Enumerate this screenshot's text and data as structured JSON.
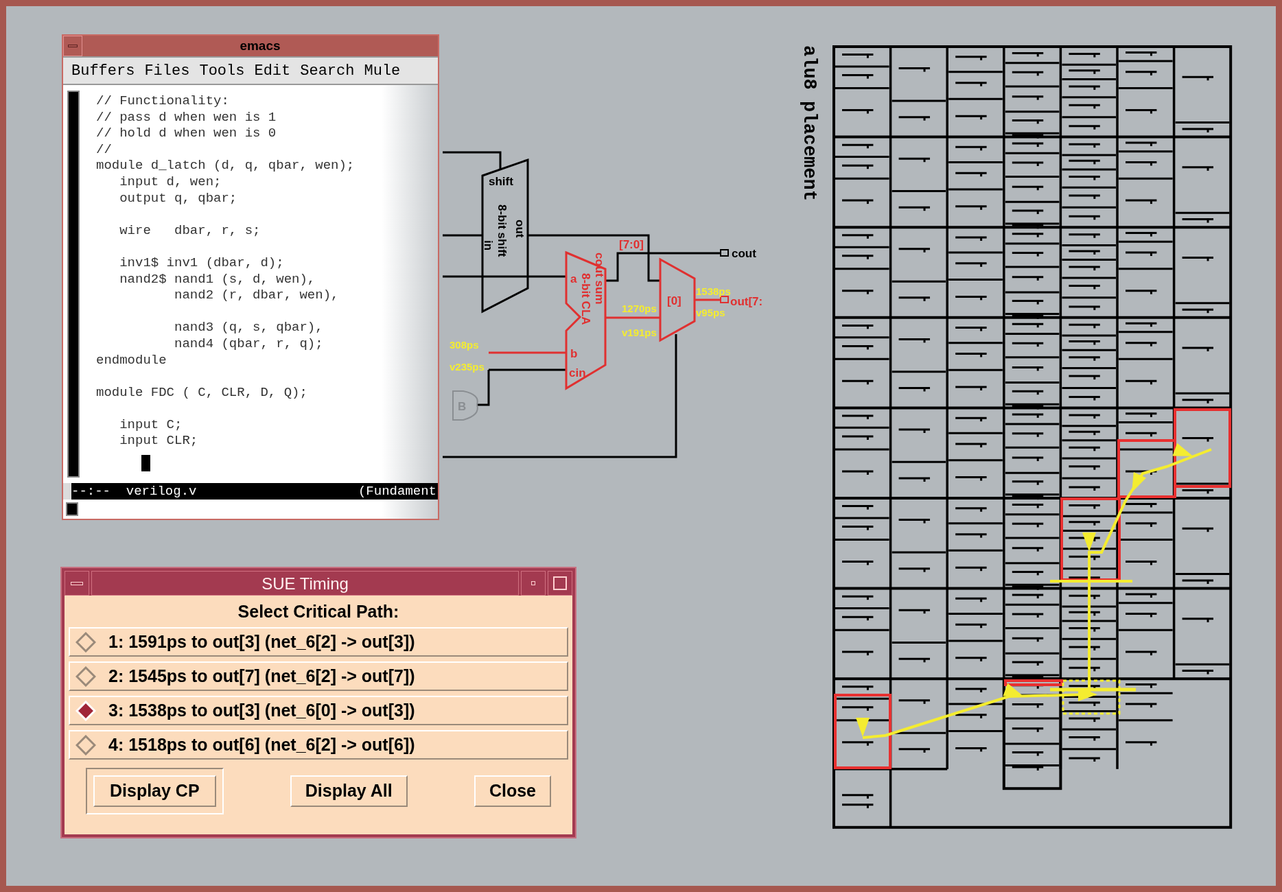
{
  "emacs": {
    "title": "emacs",
    "menu": [
      "Buffers",
      "Files",
      "Tools",
      "Edit",
      "Search",
      "Mule"
    ],
    "code": [
      {
        "text": "// Functionality:",
        "gap_before": false
      },
      {
        "text": "// pass d when wen is 1",
        "gap_before": false
      },
      {
        "text": "// hold d when wen is 0",
        "gap_before": false
      },
      {
        "text": "//",
        "gap_before": false
      },
      {
        "text": "module d_latch (d, q, qbar, wen);",
        "gap_before": false
      },
      {
        "text": "   input d, wen;",
        "gap_before": false
      },
      {
        "text": "   output q, qbar;",
        "gap_before": false
      },
      {
        "text": "   wire   dbar, r, s;",
        "gap_before": true
      },
      {
        "text": "   inv1$ inv1 (dbar, d);",
        "gap_before": true
      },
      {
        "text": "   nand2$ nand1 (s, d, wen),",
        "gap_before": false
      },
      {
        "text": "          nand2 (r, dbar, wen),",
        "gap_before": false
      },
      {
        "text": "          nand3 (q, s, qbar),",
        "gap_before": true
      },
      {
        "text": "          nand4 (qbar, r, q);",
        "gap_before": false
      },
      {
        "text": "endmodule",
        "gap_before": false
      },
      {
        "text": "module FDC ( C, CLR, D, Q);",
        "gap_before": true
      },
      {
        "text": "   input C;",
        "gap_before": true
      },
      {
        "text": "   input CLR;",
        "gap_before": false
      }
    ],
    "mode_line": {
      "left": "--:--  verilog.v",
      "right": "(Fundament"
    }
  },
  "schematic": {
    "labels": [
      {
        "text": "shift",
        "kind": "block"
      },
      {
        "text": "8-bit shift",
        "kind": "block"
      },
      {
        "text": "in",
        "kind": "block"
      },
      {
        "text": "out",
        "kind": "block"
      },
      {
        "text": "cout",
        "kind": "block"
      },
      {
        "text": "[7:0]",
        "kind": "path"
      },
      {
        "text": "a",
        "kind": "path"
      },
      {
        "text": "b",
        "kind": "path"
      },
      {
        "text": "cin",
        "kind": "path"
      },
      {
        "text": "cout sum",
        "kind": "path"
      },
      {
        "text": "8-bit CLA",
        "kind": "path"
      },
      {
        "text": "[0]",
        "kind": "path"
      },
      {
        "text": "out[7:",
        "kind": "path"
      },
      {
        "text": "1538ps",
        "kind": "delay"
      },
      {
        "text": "v95ps",
        "kind": "delay"
      },
      {
        "text": "1270ps",
        "kind": "delay"
      },
      {
        "text": "v191ps",
        "kind": "delay"
      },
      {
        "text": "308ps",
        "kind": "delay"
      },
      {
        "text": "v235ps",
        "kind": "delay"
      },
      {
        "text": "B",
        "kind": "faint"
      }
    ]
  },
  "timing_dialog": {
    "title": "SUE Timing",
    "heading": "Select Critical Path:",
    "options": [
      {
        "label": "1: 1591ps to out[3] (net_6[2] -> out[3])",
        "selected": false
      },
      {
        "label": "2: 1545ps to out[7] (net_6[2] -> out[7])",
        "selected": false
      },
      {
        "label": "3: 1538ps to out[3] (net_6[0] -> out[3])",
        "selected": true
      },
      {
        "label": "4: 1518ps to out[6] (net_6[2] -> out[6])",
        "selected": false
      }
    ],
    "buttons": [
      {
        "label": "Display CP",
        "focused": true
      },
      {
        "label": "Display All",
        "focused": false
      },
      {
        "label": "Close",
        "focused": false
      }
    ]
  },
  "placement": {
    "title": "alu8 placement"
  }
}
